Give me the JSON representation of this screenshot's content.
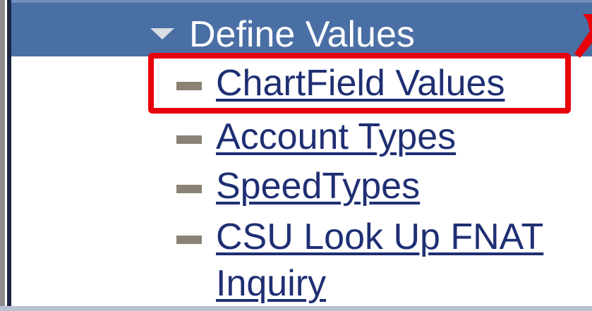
{
  "menu": {
    "section_title": "Define Values",
    "items": [
      {
        "label": "ChartField Values",
        "highlighted": true
      },
      {
        "label": "Account Types",
        "highlighted": false
      },
      {
        "label": "SpeedTypes",
        "highlighted": false
      },
      {
        "label_line1": "CSU Look Up FNAT",
        "label_line2": "Inquiry",
        "highlighted": false
      }
    ]
  },
  "icons": {
    "section_toggle": "collapse-triangle-icon",
    "item_bullet": "dash-bullet-icon",
    "callout": "red-arrow-icon"
  },
  "colors": {
    "header_bg": "#4a6fa5",
    "link": "#1f2f73",
    "highlight": "#e8000b",
    "bullet": "#8a8375"
  }
}
